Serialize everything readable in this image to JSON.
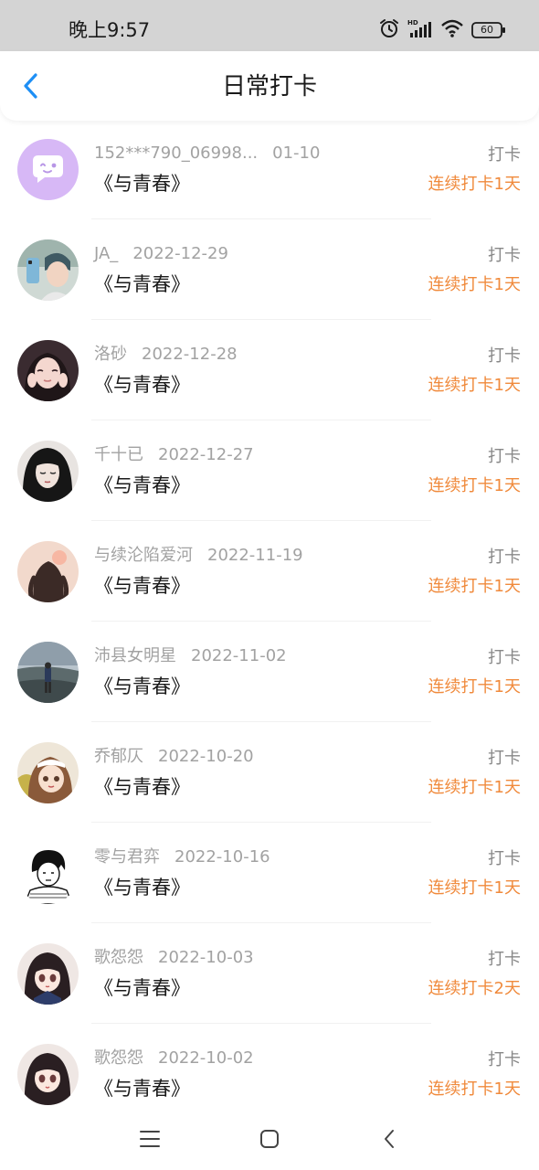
{
  "status_bar": {
    "time": "晚上9:57",
    "battery": "60",
    "icons": [
      "alarm-icon",
      "hd-signal-icon",
      "wifi-icon",
      "battery-icon"
    ]
  },
  "header": {
    "back_icon": "chevron-left-icon",
    "title": "日常打卡"
  },
  "colors": {
    "accent_blue": "#1e8ff5",
    "streak_orange": "#f08a3c"
  },
  "list": {
    "items": [
      {
        "user": "152***790_06998...",
        "date": "01-10",
        "book": "《与青春》",
        "action": "打卡",
        "streak": "连续打卡1天",
        "avatar": "chat-bubble-avatar"
      },
      {
        "user": "JA_",
        "date": "2022-12-29",
        "book": "《与青春》",
        "action": "打卡",
        "streak": "连续打卡1天",
        "avatar": "photo-avatar"
      },
      {
        "user": "洛砂",
        "date": "2022-12-28",
        "book": "《与青春》",
        "action": "打卡",
        "streak": "连续打卡1天",
        "avatar": "photo-avatar"
      },
      {
        "user": "千十已",
        "date": "2022-12-27",
        "book": "《与青春》",
        "action": "打卡",
        "streak": "连续打卡1天",
        "avatar": "illustration-avatar"
      },
      {
        "user": "与续沦陷爱河",
        "date": "2022-11-19",
        "book": "《与青春》",
        "action": "打卡",
        "streak": "连续打卡1天",
        "avatar": "illustration-avatar"
      },
      {
        "user": "沛县女明星",
        "date": "2022-11-02",
        "book": "《与青春》",
        "action": "打卡",
        "streak": "连续打卡1天",
        "avatar": "photo-avatar"
      },
      {
        "user": "乔郁仄",
        "date": "2022-10-20",
        "book": "《与青春》",
        "action": "打卡",
        "streak": "连续打卡1天",
        "avatar": "anime-avatar"
      },
      {
        "user": "零与君弈",
        "date": "2022-10-16",
        "book": "《与青春》",
        "action": "打卡",
        "streak": "连续打卡1天",
        "avatar": "sketch-avatar"
      },
      {
        "user": "歌怨怨",
        "date": "2022-10-03",
        "book": "《与青春》",
        "action": "打卡",
        "streak": "连续打卡2天",
        "avatar": "anime-avatar"
      },
      {
        "user": "歌怨怨",
        "date": "2022-10-02",
        "book": "《与青春》",
        "action": "打卡",
        "streak": "连续打卡1天",
        "avatar": "anime-avatar"
      }
    ]
  },
  "nav_bar": {
    "icons": [
      "menu-icon",
      "home-icon",
      "back-icon"
    ]
  }
}
